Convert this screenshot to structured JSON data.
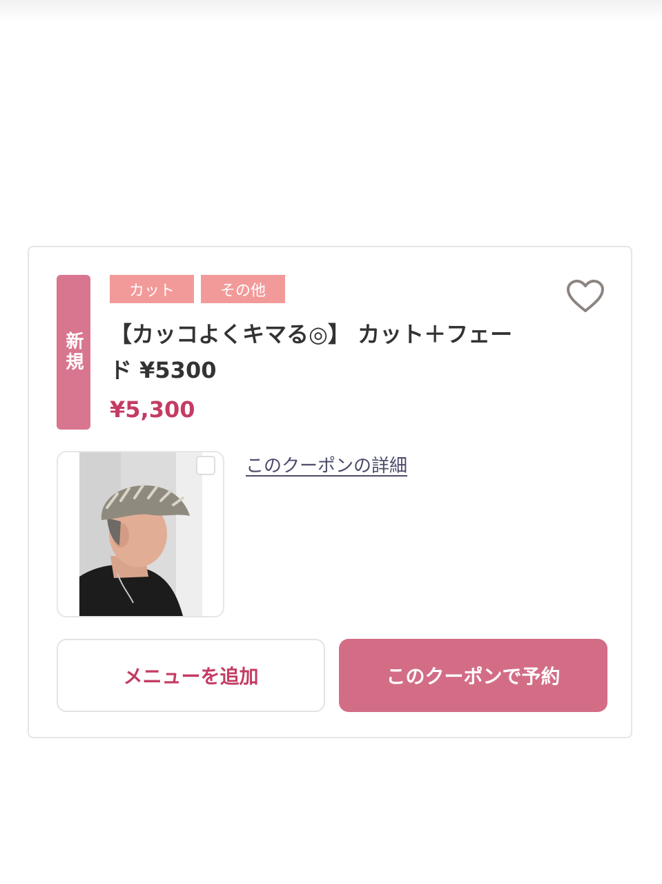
{
  "coupon": {
    "badge": "新規",
    "tags": [
      "カット",
      "その他"
    ],
    "title": "【カッコよくキマる◎】 カット＋フェード ¥5300",
    "price": "¥5,300",
    "detail_link": "このクーポンの詳細",
    "add_menu_label": "メニューを追加",
    "reserve_label": "このクーポンで予約",
    "favorite_icon": "heart-outline-icon"
  },
  "colors": {
    "badge": "#d9768f",
    "tag": "#f29a9a",
    "price": "#c43c63",
    "reserve_button": "#d36d86"
  }
}
